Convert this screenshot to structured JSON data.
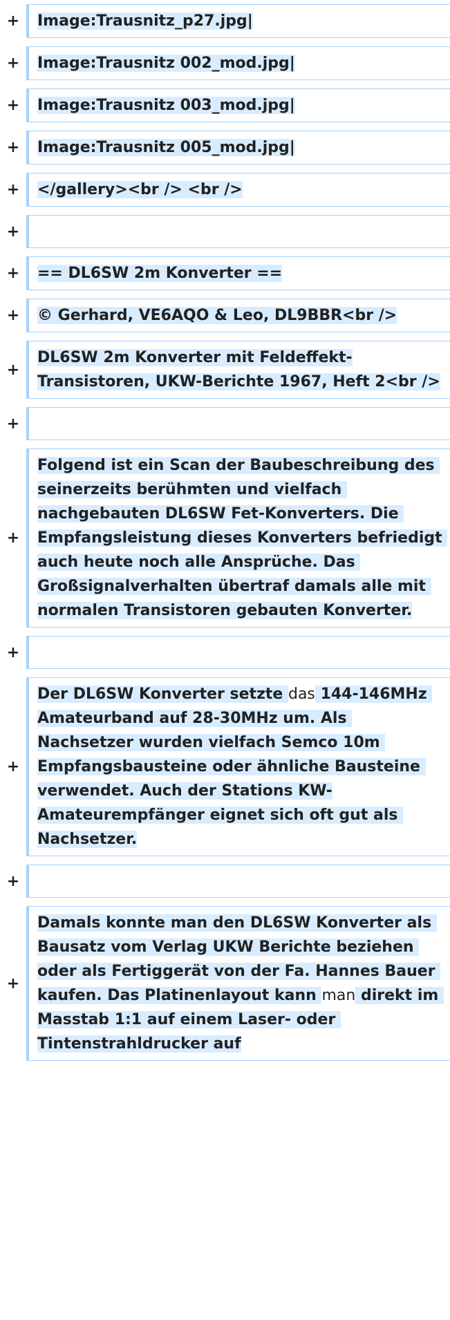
{
  "diff": {
    "marker": "+",
    "lines": [
      {
        "text": "Image:Trausnitz_p27.jpg|"
      },
      {
        "text": "Image:Trausnitz 002_mod.jpg|"
      },
      {
        "text": "Image:Trausnitz 003_mod.jpg|"
      },
      {
        "text": "Image:Trausnitz 005_mod.jpg|"
      },
      {
        "text": "</gallery><br /> <br />"
      },
      {
        "text": ""
      },
      {
        "text": "== DL6SW 2m Konverter =="
      },
      {
        "text": "© Gerhard, VE6AQO & Leo, DL9BBR<br />"
      },
      {
        "text": "DL6SW 2m Konverter mit Feldeffekt-Transistoren, UKW-Berichte 1967, Heft 2<br />"
      },
      {
        "text": ""
      },
      {
        "text": "Folgend ist ein Scan der Baubeschreibung des seinerzeits berühmten und vielfach nachgebauten DL6SW Fet-Konverters. Die Empfangsleistung dieses Konverters befriedigt auch heute noch alle Ansprüche. Das Großsignalverhalten übertraf damals alle mit normalen Transistoren gebauten Konverter."
      },
      {
        "text": ""
      },
      {
        "segments": [
          "Der DL6SW Konverter setzte ",
          "das",
          " 144-146MHz Amateurband auf 28-30MHz um. Als Nachsetzer wurden vielfach Semco 10m Empfangsbausteine oder ähnliche Bausteine verwendet. Auch der Stations KW-Amateurempfänger eignet sich oft gut als Nachsetzer."
        ]
      },
      {
        "text": ""
      },
      {
        "segments": [
          "Damals konnte man den DL6SW Konverter als Bausatz vom Verlag UKW Berichte beziehen oder als Fertiggerät von der Fa. Hannes Bauer kaufen. Das Platinenlayout kann ",
          "man",
          " direkt im Masstab 1:1 auf einem Laser- oder Tintenstrahldrucker auf"
        ]
      }
    ]
  }
}
